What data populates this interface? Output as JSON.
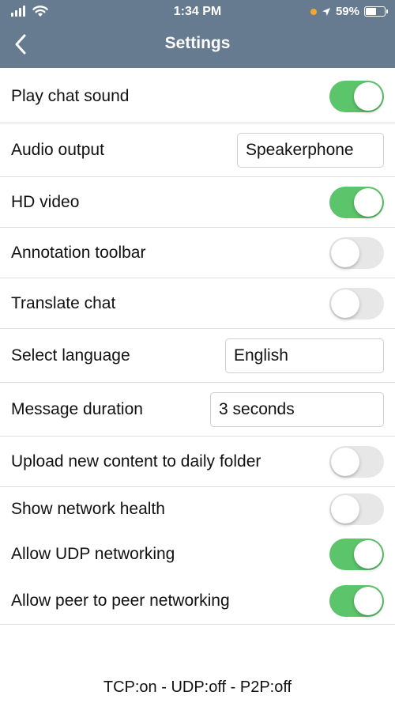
{
  "status_bar": {
    "time": "1:34 PM",
    "battery": "59%",
    "battery_level": 0.59,
    "location_dot_color": "#f5a623"
  },
  "nav": {
    "title": "Settings",
    "back_icon": "chevron-left-icon"
  },
  "settings": {
    "play_chat_sound": {
      "label": "Play chat sound",
      "on": true
    },
    "audio_output": {
      "label": "Audio output",
      "value": "Speakerphone"
    },
    "hd_video": {
      "label": "HD video",
      "on": true
    },
    "annotation_toolbar": {
      "label": "Annotation toolbar",
      "on": false
    },
    "translate_chat": {
      "label": "Translate chat",
      "on": false
    },
    "select_language": {
      "label": "Select language",
      "value": "English"
    },
    "message_duration": {
      "label": "Message duration",
      "value": "3 seconds"
    },
    "upload_daily_folder": {
      "label": "Upload new content to daily folder",
      "on": false
    },
    "show_network_health": {
      "label": "Show network health",
      "on": false
    },
    "allow_udp": {
      "label": "Allow UDP networking",
      "on": true
    },
    "allow_p2p": {
      "label": "Allow peer to peer networking",
      "on": true
    }
  },
  "footer": {
    "network_status": "TCP:on - UDP:off - P2P:off"
  },
  "colors": {
    "header": "#667b8f",
    "toggle_on": "#5cc46a",
    "toggle_off": "#e7e7e7"
  }
}
